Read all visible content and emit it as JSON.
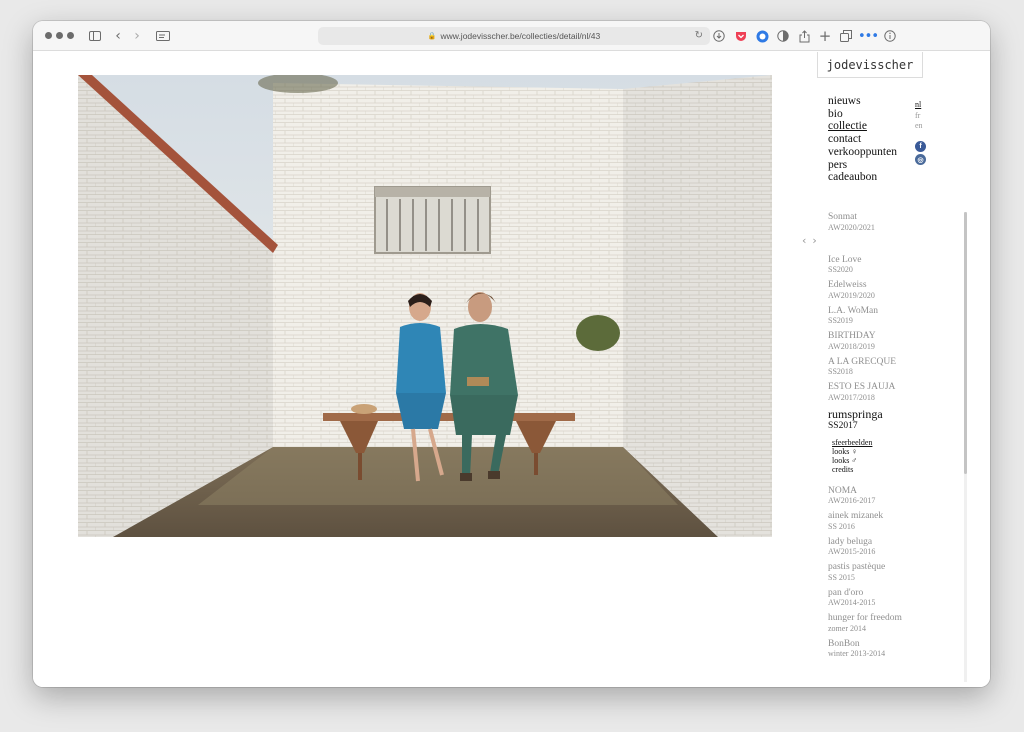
{
  "browser": {
    "url": "www.jodevisscher.be/collecties/detail/nl/43",
    "icons": [
      "sidebar-icon",
      "back-icon",
      "forward-icon",
      "reader-icon",
      "lock-icon",
      "reload-icon",
      "download-icon",
      "pocket-icon",
      "extension-icon",
      "contrast-icon",
      "share-icon",
      "new-tab-icon",
      "tabs-icon",
      "more-icon",
      "info-icon"
    ]
  },
  "site": {
    "logo": "jodevisscher",
    "nav": [
      {
        "label": "nieuws",
        "active": false
      },
      {
        "label": "bio",
        "active": false
      },
      {
        "label": "collectie",
        "active": true
      },
      {
        "label": "contact",
        "active": false
      },
      {
        "label": "verkooppunten",
        "active": false
      },
      {
        "label": "pers",
        "active": false
      },
      {
        "label": "cadeaubon",
        "active": false
      }
    ],
    "languages": [
      {
        "code": "nl",
        "active": true
      },
      {
        "code": "fr",
        "active": false
      },
      {
        "code": "en",
        "active": false
      }
    ],
    "social": {
      "facebook": "f",
      "instagram": "◎"
    },
    "slider": {
      "prev": "‹",
      "next": "›"
    }
  },
  "collections": {
    "top": {
      "name": "Sonmat",
      "season": "AW2020/2021"
    },
    "items_before": [
      {
        "name": "Ice Love",
        "season": "SS2020"
      },
      {
        "name": "Edelweiss",
        "season": "AW2019/2020"
      },
      {
        "name": "L.A. WoMan",
        "season": "SS2019"
      },
      {
        "name": "BIRTHDAY",
        "season": "AW2018/2019"
      },
      {
        "name": "A LA GRECQUE",
        "season": "SS2018"
      },
      {
        "name": "ESTO ES JAUJA",
        "season": "AW2017/2018"
      }
    ],
    "current": {
      "name": "rumspringa",
      "season": "SS2017",
      "sub": [
        {
          "label": "sfeerbeelden",
          "active": true
        },
        {
          "label": "looks ♀",
          "active": false
        },
        {
          "label": "looks ♂",
          "active": false
        },
        {
          "label": "credits",
          "active": false
        }
      ]
    },
    "items_after": [
      {
        "name": "NOMA",
        "season": "AW2016-2017"
      },
      {
        "name": "ainek mizanek",
        "season": "SS 2016"
      },
      {
        "name": "lady beluga",
        "season": "AW2015-2016"
      },
      {
        "name": "pastis pastèque",
        "season": "SS 2015"
      },
      {
        "name": "pan d'oro",
        "season": "AW2014-2015"
      },
      {
        "name": "hunger for freedom",
        "season": "zomer 2014"
      },
      {
        "name": "BonBon",
        "season": "winter 2013-2014"
      }
    ]
  }
}
